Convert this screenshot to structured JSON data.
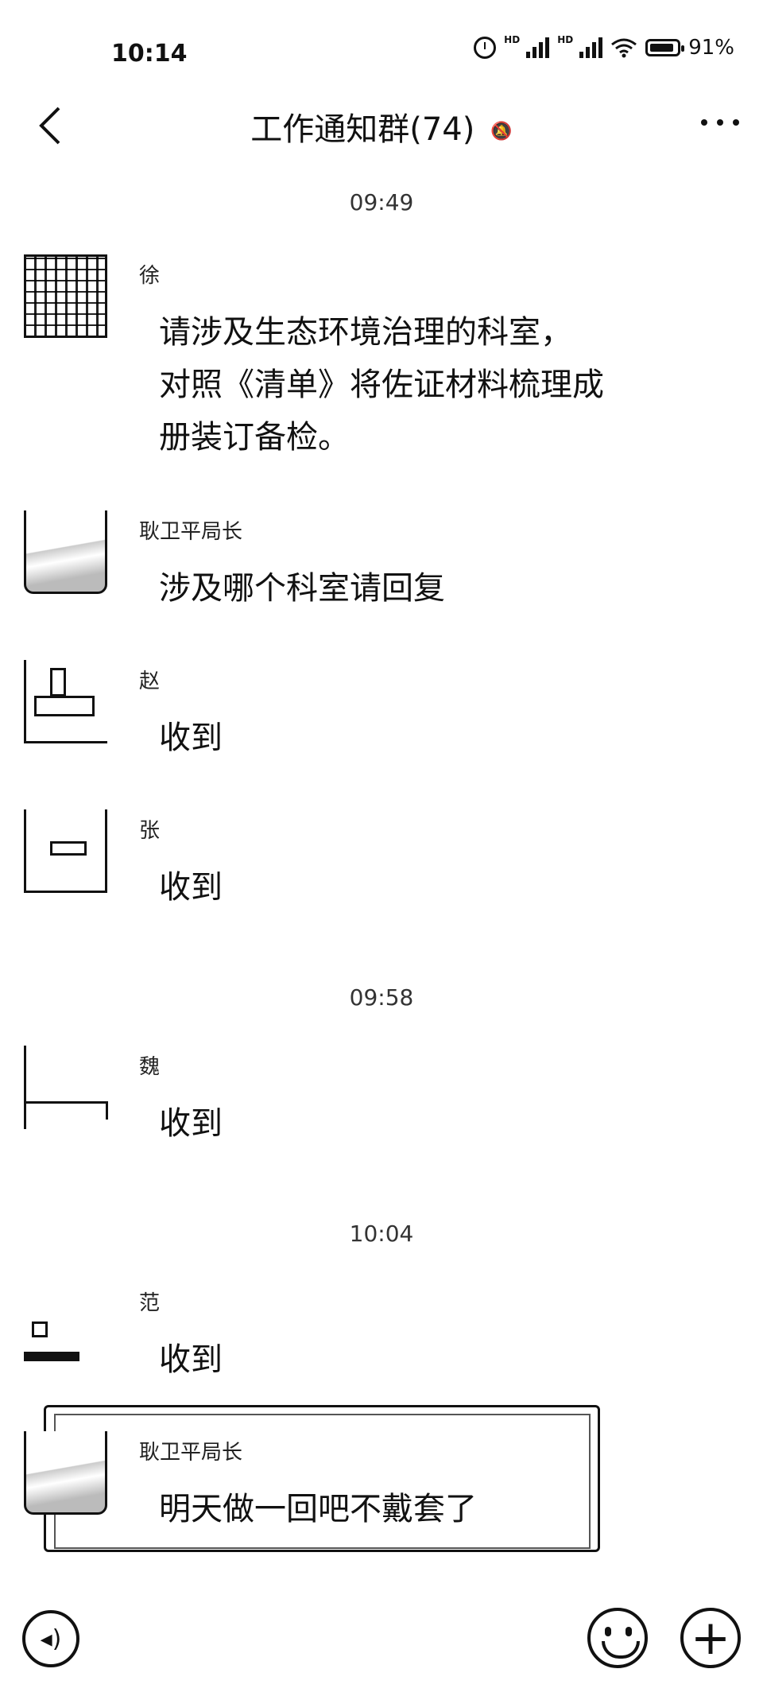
{
  "status": {
    "time": "10:14",
    "battery": "91%",
    "battery_level": 0.91,
    "network_badge": "HD"
  },
  "header": {
    "title": "工作通知群(74)"
  },
  "timestamps": [
    "09:49",
    "09:58",
    "10:04"
  ],
  "messages": [
    {
      "sender": "徐",
      "lines": [
        "请涉及生态环境治理的科室，",
        "对照《清单》将佐证材料梳理成",
        "册装订备检。"
      ]
    },
    {
      "sender": "耿卫平局长",
      "lines": [
        "涉及哪个科室请回复"
      ]
    },
    {
      "sender": "赵",
      "lines": [
        "收到"
      ]
    },
    {
      "sender": "张",
      "lines": [
        "收到"
      ]
    },
    {
      "sender": "魏",
      "lines": [
        "收到"
      ]
    },
    {
      "sender": "范",
      "lines": [
        "收到"
      ]
    },
    {
      "sender": "耿卫平局长",
      "lines": [
        "明天做一回吧不戴套了"
      ]
    }
  ],
  "icons": [
    "back-icon",
    "more-icon",
    "voice-icon",
    "emoji-icon",
    "plus-icon"
  ]
}
